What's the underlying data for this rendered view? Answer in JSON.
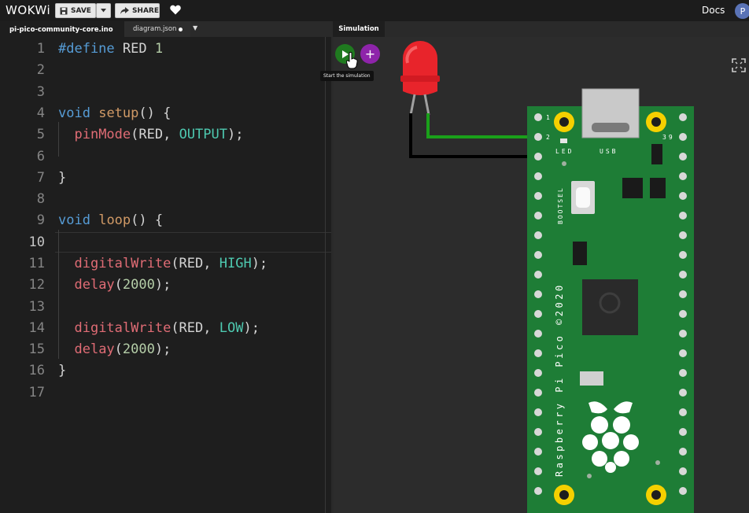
{
  "app": {
    "logo": "WOKWi"
  },
  "toolbar": {
    "save_label": "SAVE",
    "share_label": "SHARE",
    "docs_label": "Docs",
    "avatar_initial": "P"
  },
  "editor_tabs": [
    {
      "label": "pi-pico-community-core.ino"
    },
    {
      "label": "diagram.json"
    }
  ],
  "sim_tab": {
    "label": "Simulation"
  },
  "sim": {
    "tooltip": "Start the simulation",
    "add_label": "+"
  },
  "code": {
    "line_numbers": [
      "1",
      "2",
      "3",
      "4",
      "5",
      "6",
      "7",
      "8",
      "9",
      "10",
      "11",
      "12",
      "13",
      "14",
      "15",
      "16",
      "17"
    ],
    "active_line": 10,
    "lines": [
      "#define RED 1",
      "",
      "",
      "void setup() {",
      "  pinMode(RED, OUTPUT);",
      "",
      "}",
      "",
      "void loop() {",
      "",
      "  digitalWrite(RED, HIGH);",
      "  delay(2000);",
      "",
      "  digitalWrite(RED, LOW);",
      "  delay(2000);",
      "}",
      ""
    ]
  },
  "board": {
    "pin_labels": [
      "1",
      "2",
      "39"
    ],
    "led_label": "LED",
    "usb_label": "USB",
    "bootsel_label": "BOOTSEL",
    "brand_label": "Raspberry Pi Pico ©2020"
  },
  "colors": {
    "wire_green": "#1aa01a",
    "wire_black": "#000000",
    "board_green": "#1e7d36",
    "led_red": "#e8242b",
    "pad_yellow": "#f5d000"
  }
}
